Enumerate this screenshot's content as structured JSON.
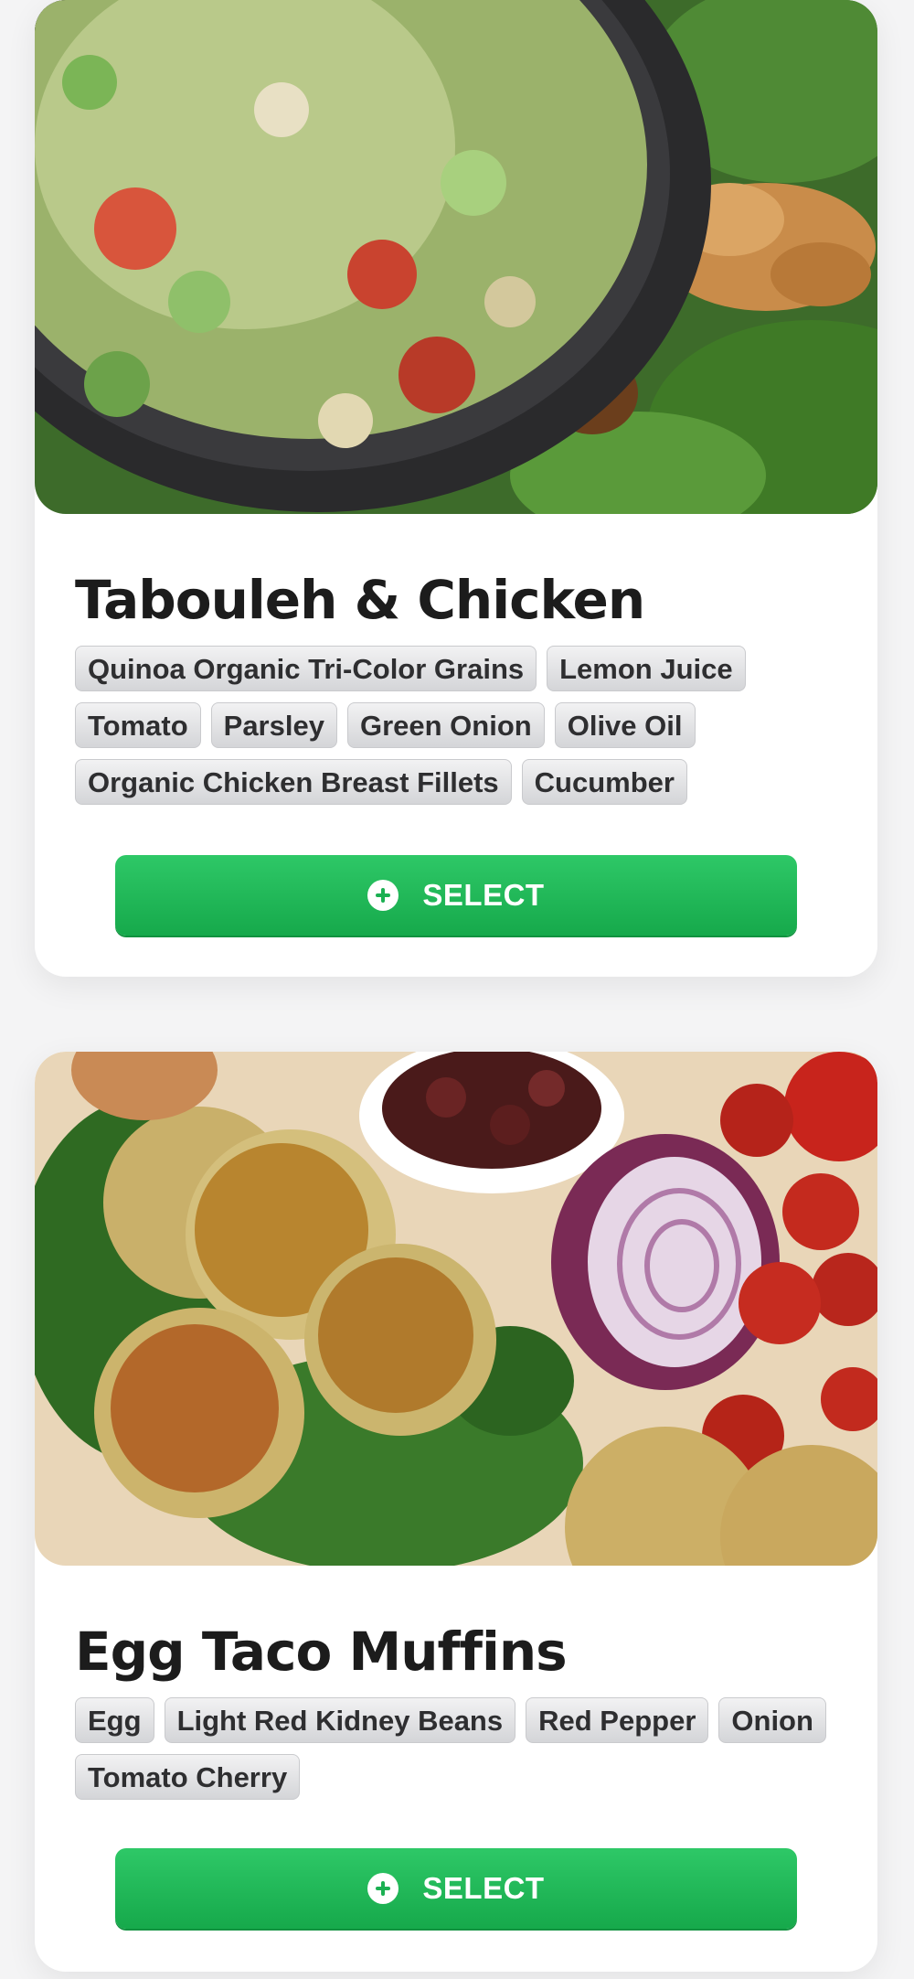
{
  "meals": [
    {
      "title": "Tabouleh & Chicken",
      "image": "tabouleh-chicken-photo",
      "ingredients": [
        "Quinoa Organic Tri-Color Grains",
        "Lemon Juice",
        "Tomato",
        "Parsley",
        "Green Onion",
        "Olive Oil",
        "Organic Chicken Breast Fillets",
        "Cucumber"
      ],
      "button_label": "SELECT",
      "button_icon": "plus-circle-icon"
    },
    {
      "title": "Egg Taco Muffins",
      "image": "egg-taco-muffins-photo",
      "ingredients": [
        "Egg",
        "Light Red Kidney Beans",
        "Red Pepper",
        "Onion",
        "Tomato Cherry"
      ],
      "button_label": "SELECT",
      "button_icon": "plus-circle-icon"
    }
  ],
  "colors": {
    "button_green": "#1fb957",
    "tag_gray": "#e2e3e5",
    "title_text": "#1c1c1c",
    "page_background": "#f4f4f5"
  }
}
